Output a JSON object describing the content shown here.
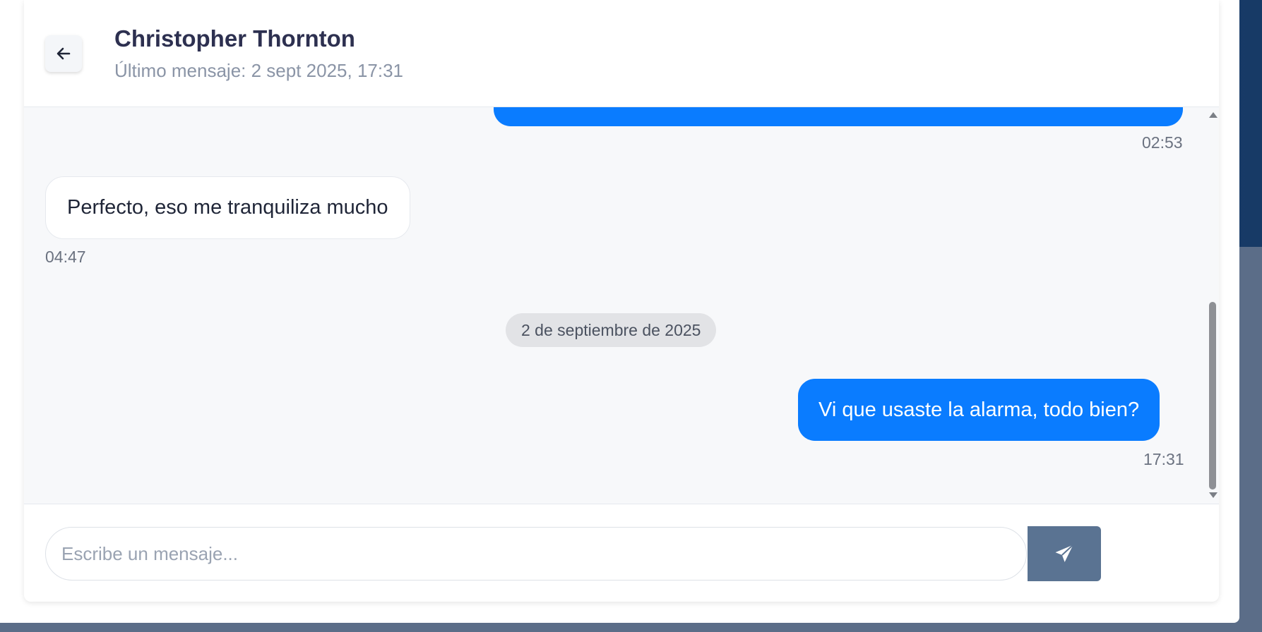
{
  "header": {
    "back_icon": "arrow-left-icon",
    "contact_name": "Christopher Thornton",
    "last_message": "Último mensaje: 2 sept 2025, 17:31"
  },
  "messages": [
    {
      "direction": "outgoing",
      "text": "",
      "time": "02:53"
    },
    {
      "direction": "incoming",
      "text": "Perfecto, eso me tranquiliza mucho",
      "time": "04:47"
    },
    {
      "direction": "outgoing",
      "text": "Vi que usaste la alarma, todo bien?",
      "time": "17:31"
    }
  ],
  "date_separator": "2 de septiembre de 2025",
  "composer": {
    "placeholder": "Escribe un mensaje...",
    "value": "",
    "send_icon": "paper-plane-icon"
  },
  "colors": {
    "outgoing_bubble": "#0a7cff",
    "incoming_bubble": "#ffffff",
    "send_button": "#5a7392",
    "page_background": "#1f4576"
  }
}
